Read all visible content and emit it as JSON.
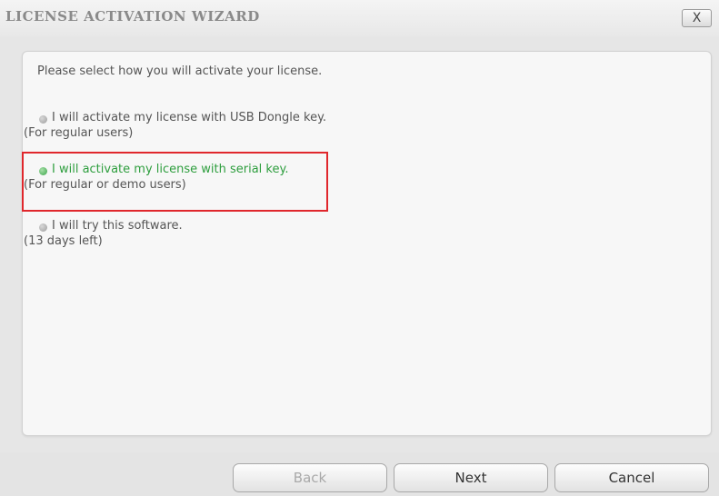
{
  "window": {
    "title": "LICENSE ACTIVATION WIZARD",
    "close_label": "X"
  },
  "content": {
    "prompt": "Please select how you will activate your license.",
    "options": [
      {
        "label": "I will activate my license with USB Dongle key.",
        "sub": "(For regular users)",
        "selected": false
      },
      {
        "label": "I will activate my license with serial key.",
        "sub": "(For regular or demo users)",
        "selected": true
      },
      {
        "label": "I will try this software.",
        "sub": "(13 days left)",
        "selected": false
      }
    ]
  },
  "footer": {
    "back_label": "Back",
    "next_label": "Next",
    "cancel_label": "Cancel"
  },
  "colors": {
    "selected_text": "#2e9e3e",
    "highlight_border": "#e0272c",
    "disabled_text": "#a9a9a9"
  }
}
